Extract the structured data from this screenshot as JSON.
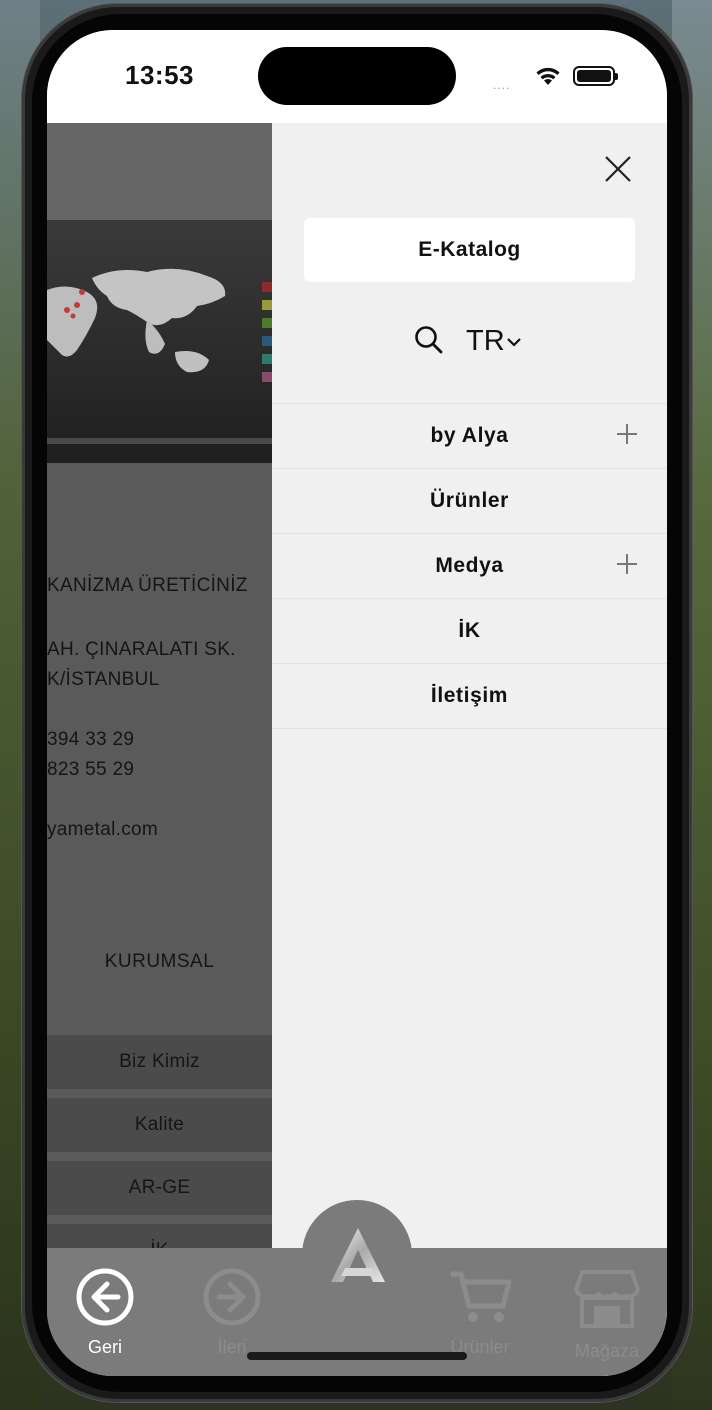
{
  "status_bar": {
    "time": "13:53",
    "signal": "...."
  },
  "background_page": {
    "address_lines": [
      "KANİZMA ÜRETİCİNİZ",
      "AH. ÇINARALATI SK.",
      "K/İSTANBUL",
      "394 33 29",
      "823 55 29",
      "yametal.com"
    ],
    "section_heading": "KURUMSAL",
    "links": [
      "Biz Kimiz",
      "Kalite",
      "AR-GE",
      "İK"
    ]
  },
  "drawer": {
    "catalog_button": "E-Katalog",
    "language": "TR",
    "menu_items": [
      {
        "label": "by Alya",
        "expandable": true
      },
      {
        "label": "Ürünler",
        "expandable": false
      },
      {
        "label": "Medya",
        "expandable": true
      },
      {
        "label": "İK",
        "expandable": false
      },
      {
        "label": "İletişim",
        "expandable": false
      }
    ]
  },
  "tab_bar": {
    "tabs": [
      {
        "label": "Geri",
        "icon": "arrow-left-circle-icon",
        "active": true
      },
      {
        "label": "İleri",
        "icon": "arrow-right-circle-icon",
        "active": false
      },
      {
        "label": "Ürünler",
        "icon": "cart-icon",
        "active": false
      },
      {
        "label": "Mağaza",
        "icon": "store-icon",
        "active": false
      }
    ],
    "center_logo": "alya-logo"
  },
  "colors": {
    "drawer_bg": "#f0f0f0",
    "overlay_page": "#5a5a5a",
    "tab_bar": "#7b7b7b",
    "active_tab": "#ffffff",
    "inactive_tab": "#8c8c8c"
  }
}
